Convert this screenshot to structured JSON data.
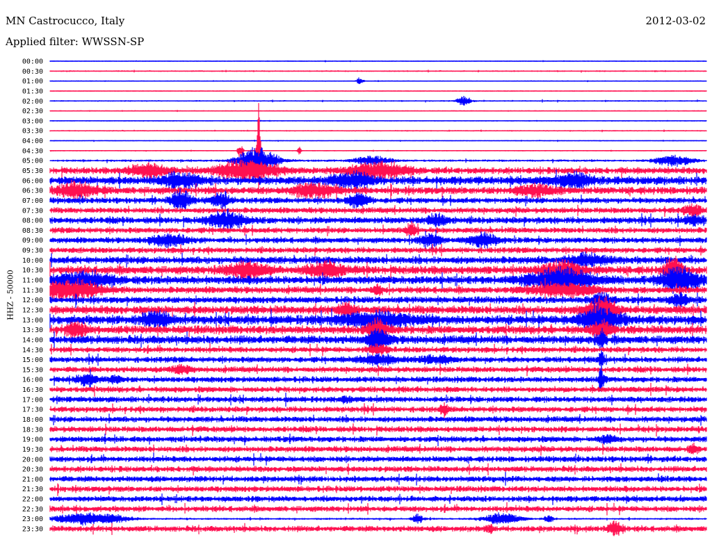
{
  "header": {
    "station": "MN Castrocucco, Italy",
    "filter": "Applied filter: WWSSN-SP",
    "date": "2012-03-02"
  },
  "chart_data": {
    "type": "line",
    "title": "MN Castrocucco, Italy",
    "subtitle": "Applied filter: WWSSN-SP",
    "date": "2012-03-02",
    "ylabel": "HHZ - 50000",
    "row_minutes": 30,
    "colors": [
      "#0000ff",
      "#ff1050"
    ],
    "note": "noise = relative trace amplitude; events = [fraction of row, relative amplitude, relative width]",
    "rows": [
      {
        "label": "00:00",
        "noise": 0.6,
        "events": []
      },
      {
        "label": "00:30",
        "noise": 0.9,
        "events": []
      },
      {
        "label": "01:00",
        "noise": 0.5,
        "events": [
          [
            0.472,
            4,
            0.004
          ]
        ]
      },
      {
        "label": "01:30",
        "noise": 0.4,
        "events": []
      },
      {
        "label": "02:00",
        "noise": 0.9,
        "events": [
          [
            0.631,
            5,
            0.008
          ]
        ]
      },
      {
        "label": "02:30",
        "noise": 0.5,
        "events": []
      },
      {
        "label": "03:00",
        "noise": 0.5,
        "events": []
      },
      {
        "label": "03:30",
        "noise": 0.8,
        "events": []
      },
      {
        "label": "04:00",
        "noise": 0.6,
        "events": []
      },
      {
        "label": "04:30",
        "noise": 0.6,
        "events": [
          [
            0.318,
            55,
            0.002
          ],
          [
            0.29,
            8,
            0.003
          ],
          [
            0.38,
            5,
            0.002
          ]
        ]
      },
      {
        "label": "05:00",
        "noise": 1.4,
        "events": [
          [
            0.316,
            16,
            0.02
          ],
          [
            0.95,
            6,
            0.02
          ],
          [
            0.49,
            5,
            0.02
          ]
        ]
      },
      {
        "label": "05:30",
        "noise": 4,
        "events": [
          [
            0.3,
            12,
            0.03
          ],
          [
            0.5,
            9,
            0.03
          ],
          [
            0.15,
            8,
            0.02
          ]
        ]
      },
      {
        "label": "06:00",
        "noise": 5,
        "events": [
          [
            0.2,
            8,
            0.02
          ],
          [
            0.46,
            9,
            0.02
          ],
          [
            0.8,
            7,
            0.02
          ]
        ]
      },
      {
        "label": "06:30",
        "noise": 4.5,
        "events": [
          [
            0.04,
            8,
            0.02
          ],
          [
            0.4,
            8,
            0.02
          ],
          [
            0.74,
            6,
            0.02
          ]
        ]
      },
      {
        "label": "07:00",
        "noise": 3.5,
        "events": [
          [
            0.2,
            12,
            0.01
          ],
          [
            0.47,
            9,
            0.01
          ],
          [
            0.26,
            8,
            0.01
          ]
        ]
      },
      {
        "label": "07:30",
        "noise": 3.5,
        "events": [
          [
            0.98,
            6,
            0.01
          ]
        ]
      },
      {
        "label": "08:00",
        "noise": 4,
        "events": [
          [
            0.27,
            9,
            0.02
          ],
          [
            0.59,
            6,
            0.01
          ],
          [
            0.98,
            5,
            0.01
          ]
        ]
      },
      {
        "label": "08:30",
        "noise": 3.5,
        "events": [
          [
            0.55,
            8,
            0.005
          ]
        ]
      },
      {
        "label": "09:00",
        "noise": 3.5,
        "events": [
          [
            0.18,
            6,
            0.02
          ],
          [
            0.58,
            8,
            0.01
          ],
          [
            0.66,
            8,
            0.015
          ]
        ]
      },
      {
        "label": "09:30",
        "noise": 3.5,
        "events": []
      },
      {
        "label": "10:00",
        "noise": 4.5,
        "events": [
          [
            0.82,
            6,
            0.02
          ]
        ]
      },
      {
        "label": "10:30",
        "noise": 5,
        "events": [
          [
            0.3,
            9,
            0.02
          ],
          [
            0.42,
            8,
            0.02
          ],
          [
            0.78,
            10,
            0.02
          ],
          [
            0.95,
            18,
            0.008
          ]
        ]
      },
      {
        "label": "11:00",
        "noise": 5,
        "events": [
          [
            0.78,
            13,
            0.035
          ],
          [
            0.96,
            14,
            0.02
          ],
          [
            0.05,
            8,
            0.03
          ]
        ]
      },
      {
        "label": "11:30",
        "noise": 4,
        "events": [
          [
            0.03,
            12,
            0.03
          ],
          [
            0.78,
            7,
            0.035
          ],
          [
            0.5,
            6,
            0.005
          ]
        ]
      },
      {
        "label": "12:00",
        "noise": 4,
        "events": [
          [
            0.84,
            9,
            0.01
          ],
          [
            0.96,
            8,
            0.01
          ]
        ]
      },
      {
        "label": "12:30",
        "noise": 5,
        "events": [
          [
            0.84,
            14,
            0.015
          ],
          [
            0.45,
            7,
            0.01
          ]
        ]
      },
      {
        "label": "13:00",
        "noise": 5.5,
        "events": [
          [
            0.84,
            14,
            0.02
          ],
          [
            0.16,
            9,
            0.015
          ],
          [
            0.5,
            8,
            0.04
          ]
        ]
      },
      {
        "label": "13:30",
        "noise": 5,
        "events": [
          [
            0.04,
            8,
            0.01
          ],
          [
            0.5,
            12,
            0.01
          ],
          [
            0.84,
            10,
            0.01
          ]
        ]
      },
      {
        "label": "14:00",
        "noise": 5,
        "events": [
          [
            0.5,
            14,
            0.01
          ],
          [
            0.84,
            9,
            0.005
          ]
        ]
      },
      {
        "label": "14:30",
        "noise": 3.5,
        "events": [
          [
            0.5,
            6,
            0.01
          ]
        ]
      },
      {
        "label": "15:00",
        "noise": 3.5,
        "events": [
          [
            0.5,
            5,
            0.02
          ],
          [
            0.59,
            4,
            0.02
          ],
          [
            0.84,
            10,
            0.003
          ]
        ]
      },
      {
        "label": "15:30",
        "noise": 3.5,
        "events": [
          [
            0.2,
            4,
            0.01
          ]
        ]
      },
      {
        "label": "16:00",
        "noise": 3.5,
        "events": [
          [
            0.056,
            6,
            0.01
          ],
          [
            0.1,
            4,
            0.008
          ],
          [
            0.84,
            12,
            0.003
          ]
        ]
      },
      {
        "label": "16:30",
        "noise": 3.5,
        "events": []
      },
      {
        "label": "17:00",
        "noise": 3.5,
        "events": [
          [
            0.45,
            4,
            0.005
          ]
        ]
      },
      {
        "label": "17:30",
        "noise": 3.5,
        "events": [
          [
            0.6,
            4,
            0.005
          ]
        ]
      },
      {
        "label": "18:00",
        "noise": 3.5,
        "events": []
      },
      {
        "label": "18:30",
        "noise": 3.5,
        "events": []
      },
      {
        "label": "19:00",
        "noise": 3.5,
        "events": [
          [
            0.85,
            5,
            0.008
          ]
        ]
      },
      {
        "label": "19:30",
        "noise": 3.5,
        "events": [
          [
            0.98,
            5,
            0.005
          ]
        ]
      },
      {
        "label": "20:00",
        "noise": 3.5,
        "events": []
      },
      {
        "label": "20:30",
        "noise": 3.5,
        "events": []
      },
      {
        "label": "21:00",
        "noise": 3.5,
        "events": []
      },
      {
        "label": "21:30",
        "noise": 3.5,
        "events": []
      },
      {
        "label": "22:00",
        "noise": 3.5,
        "events": []
      },
      {
        "label": "22:30",
        "noise": 3.5,
        "events": []
      },
      {
        "label": "23:00",
        "noise": 1.2,
        "events": [
          [
            0.05,
            7,
            0.03
          ],
          [
            0.1,
            3,
            0.02
          ],
          [
            0.56,
            6,
            0.005
          ],
          [
            0.69,
            7,
            0.02
          ],
          [
            0.76,
            4,
            0.005
          ]
        ]
      },
      {
        "label": "23:30",
        "noise": 3.5,
        "events": [
          [
            0.86,
            10,
            0.006
          ],
          [
            0.67,
            4,
            0.005
          ]
        ]
      }
    ]
  }
}
